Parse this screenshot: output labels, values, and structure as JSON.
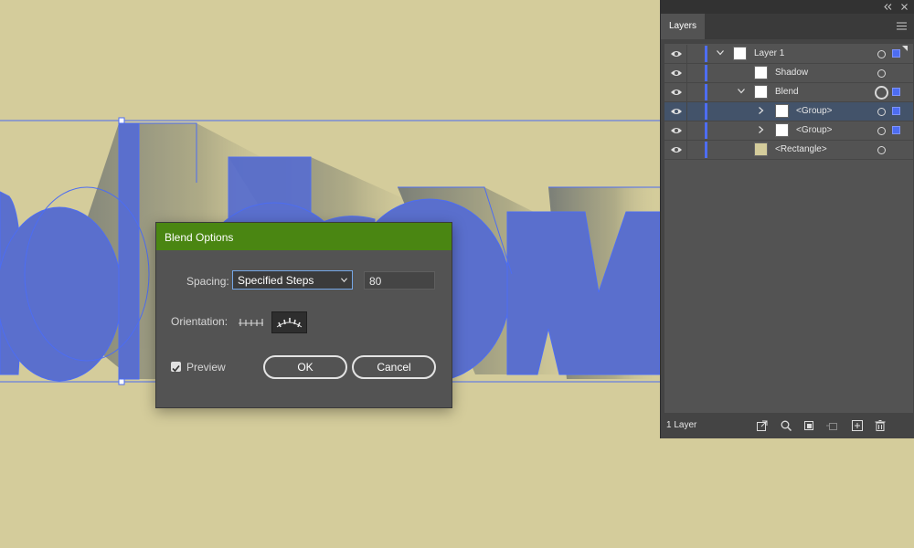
{
  "dialog": {
    "title": "Blend Options",
    "spacing_label": "Spacing:",
    "spacing_value": "Specified Steps",
    "steps_value": "80",
    "orientation_label": "Orientation:",
    "preview_label": "Preview",
    "preview_checked": true,
    "ok_label": "OK",
    "cancel_label": "Cancel"
  },
  "layers_panel": {
    "tab_label": "Layers",
    "footer_label": "1 Layer",
    "rows": [
      {
        "name": "Layer 1",
        "expanded": true,
        "selected": false
      },
      {
        "name": "Shadow",
        "selected": false
      },
      {
        "name": "Blend",
        "expanded": true,
        "selected": false
      },
      {
        "name": "<Group>",
        "expanded": false,
        "selected": true
      },
      {
        "name": "<Group>",
        "expanded": false,
        "selected": false
      },
      {
        "name": "<Rectangle>",
        "selected": false
      }
    ]
  },
  "colors": {
    "background": "#d4cc9b",
    "artwork_fill": "#5a6fcd",
    "selection": "#4d6df2",
    "dialog_header": "#4a8612"
  }
}
